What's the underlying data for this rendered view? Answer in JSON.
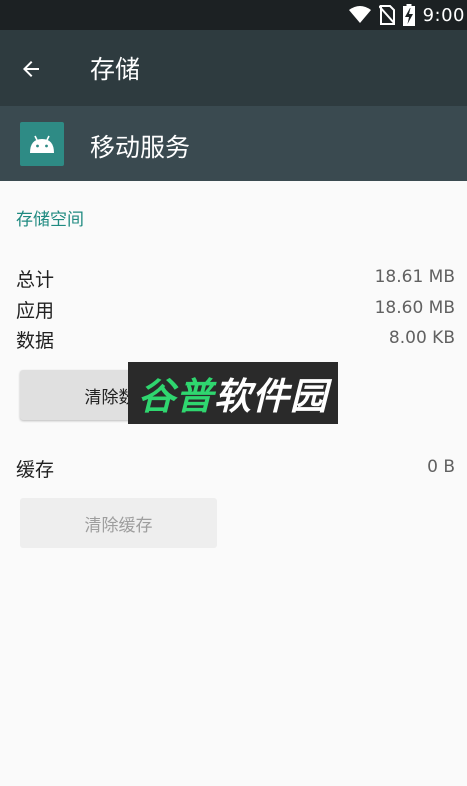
{
  "status_bar": {
    "time": "9:00",
    "icons": [
      "wifi-icon",
      "no-sim-icon",
      "battery-charging-icon"
    ]
  },
  "toolbar": {
    "title": "存储",
    "back_icon": "arrow-left-icon"
  },
  "app": {
    "name": "移动服务",
    "icon": "android-icon",
    "icon_color": "#2e8b85"
  },
  "storage": {
    "section_title": "存储空间",
    "rows": [
      {
        "label": "总计",
        "value": "18.61 MB"
      },
      {
        "label": "应用",
        "value": "18.60 MB"
      },
      {
        "label": "数据",
        "value": "8.00 KB"
      }
    ],
    "clear_data_label": "清除数据"
  },
  "cache": {
    "label": "缓存",
    "value": "0 B",
    "clear_cache_label": "清除缓存"
  },
  "watermark": {
    "accent_text": "谷普",
    "text": "软件园"
  },
  "colors": {
    "accent": "#1f8a80",
    "toolbar": "#2e3b3f",
    "header": "#3a4a50",
    "statusbar": "#1c2123"
  }
}
